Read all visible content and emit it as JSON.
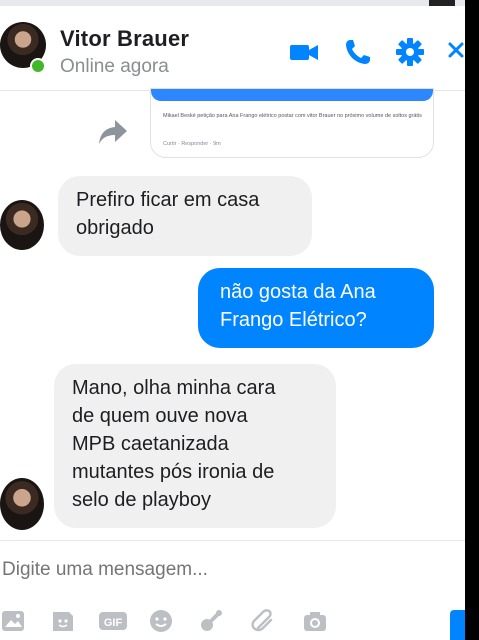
{
  "header": {
    "contact_name": "Vitor Brauer",
    "status": "Online agora",
    "icons": [
      "video-camera-icon",
      "phone-icon",
      "gear-icon",
      "close-icon"
    ]
  },
  "shared_post": {
    "text": "Mikael Beské petição para Ana Frango elétrico postar com vitor Brauer no próximo volume de soltos grátis",
    "footer": "Curtir · Responder · 9m"
  },
  "messages": [
    {
      "from": "contact",
      "text": "Prefiro ficar em casa\nobrigado"
    },
    {
      "from": "me",
      "text": "não gosta da Ana\nFrango Elétrico?"
    },
    {
      "from": "contact",
      "text": "Mano, olha minha cara\nde quem ouve nova\nMPB caetanizada\nmutantes pós ironia de\nselo de playboy"
    }
  ],
  "composer": {
    "placeholder": "Digite uma mensagem...",
    "tools": [
      "image-icon",
      "sticker-icon",
      "gif-icon",
      "emoji-icon",
      "game-icon",
      "attachment-icon",
      "camera-icon",
      "thumbs-up-icon"
    ]
  },
  "colors": {
    "accent": "#0084ff",
    "online": "#42b72a",
    "incoming_bubble": "#f1f0f0"
  }
}
